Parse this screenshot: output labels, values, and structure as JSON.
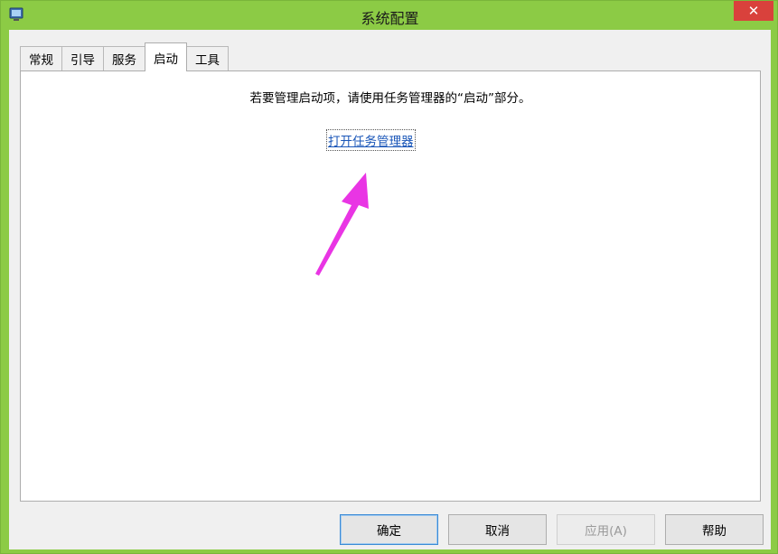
{
  "window": {
    "title": "系统配置",
    "close_label": "✕"
  },
  "tabs": [
    {
      "label": "常规"
    },
    {
      "label": "引导"
    },
    {
      "label": "服务"
    },
    {
      "label": "启动",
      "active": true
    },
    {
      "label": "工具"
    }
  ],
  "startup": {
    "info": "若要管理启动项，请使用任务管理器的“启动”部分。",
    "link": "打开任务管理器"
  },
  "buttons": {
    "ok": "确定",
    "cancel": "取消",
    "apply": "应用(A)",
    "help": "帮助"
  },
  "colors": {
    "title_bar": "#8ccb45",
    "close": "#d9413c",
    "link": "#1a56b8",
    "annotation_arrow": "#e935e4"
  },
  "icons": {
    "app": "msconfig-icon",
    "close": "close-icon",
    "annotation": "pink-arrow"
  }
}
